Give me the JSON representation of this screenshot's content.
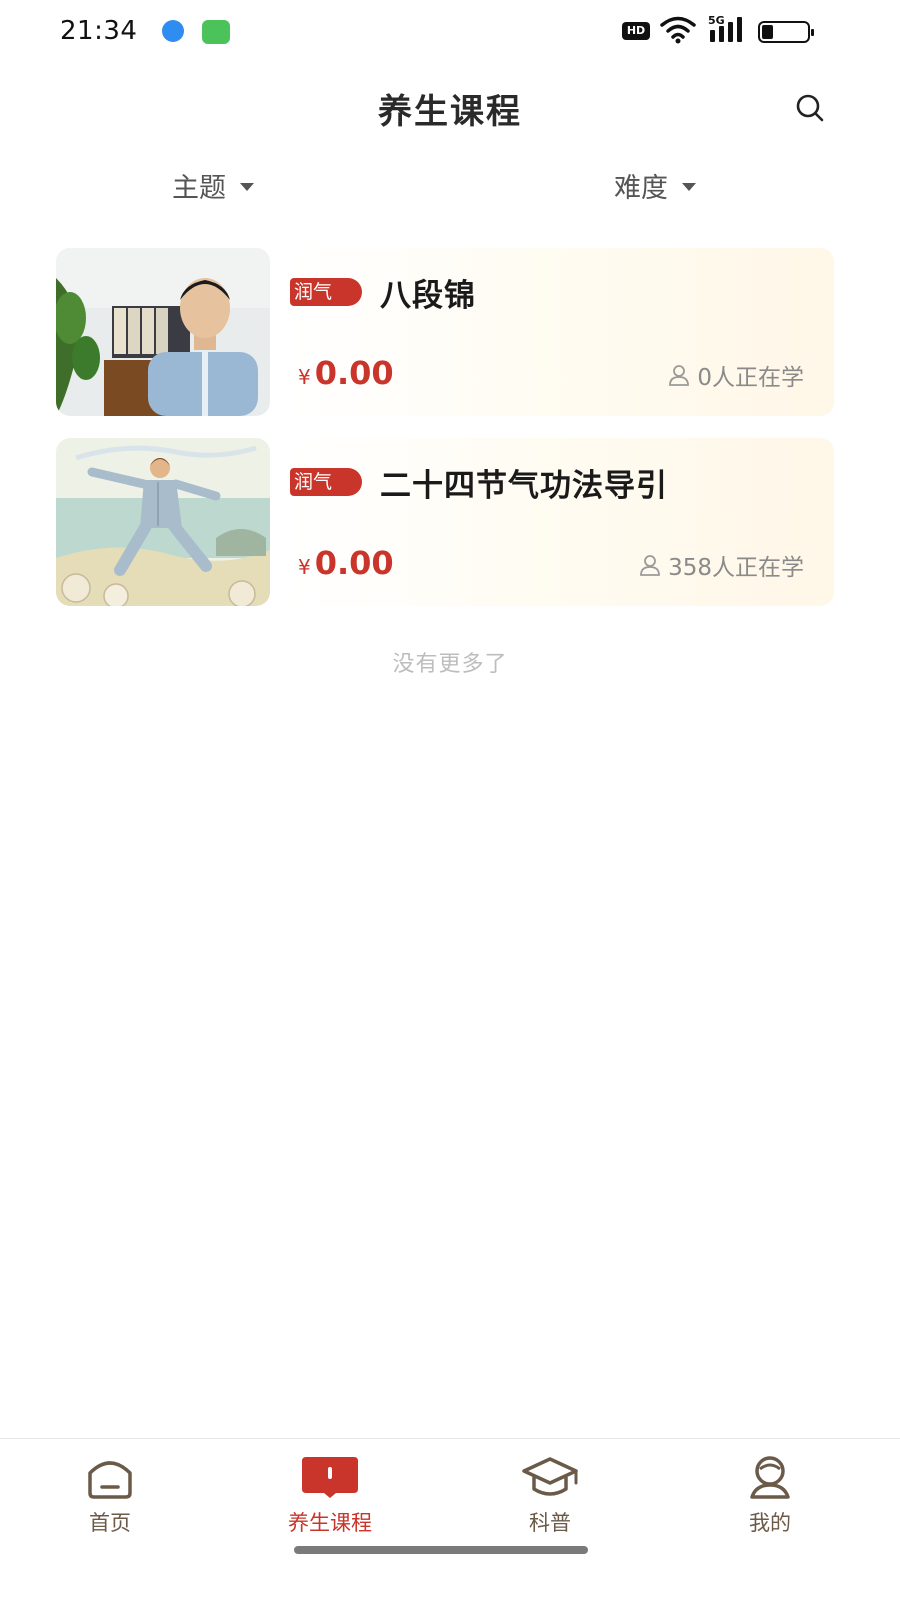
{
  "status_bar": {
    "time": "21:34",
    "hd_label": "HD",
    "network": "5G",
    "battery_level": 0.25,
    "icons": [
      "app-blue-icon",
      "message-green-icon",
      "hd-icon",
      "wifi-icon",
      "signal-5g-icon",
      "battery-icon"
    ]
  },
  "header": {
    "title": "养生课程",
    "search_icon": "search-icon"
  },
  "filters": [
    {
      "label": "主题",
      "icon": "caret-down-icon"
    },
    {
      "label": "难度",
      "icon": "caret-down-icon"
    }
  ],
  "courses": [
    {
      "tag": "润气",
      "title": "八段锦",
      "price_symbol": "¥",
      "price": "0.00",
      "learners": "0人正在学",
      "thumbnail": "instructor-video-thumbnail"
    },
    {
      "tag": "润气",
      "title": "二十四节气功法导引",
      "price_symbol": "¥",
      "price": "0.00",
      "learners": "358人正在学",
      "thumbnail": "taichi-illustration-thumbnail"
    }
  ],
  "list_footer": "没有更多了",
  "bottom_nav": [
    {
      "label": "首页",
      "icon": "home-icon",
      "active": false
    },
    {
      "label": "养生课程",
      "icon": "book-icon",
      "active": true
    },
    {
      "label": "科普",
      "icon": "graduation-cap-icon",
      "active": false
    },
    {
      "label": "我的",
      "icon": "profile-icon",
      "active": false
    }
  ],
  "colors": {
    "accent": "#c9352b",
    "nav_inactive": "#6b5a48",
    "muted_text": "#8a8a8a"
  }
}
